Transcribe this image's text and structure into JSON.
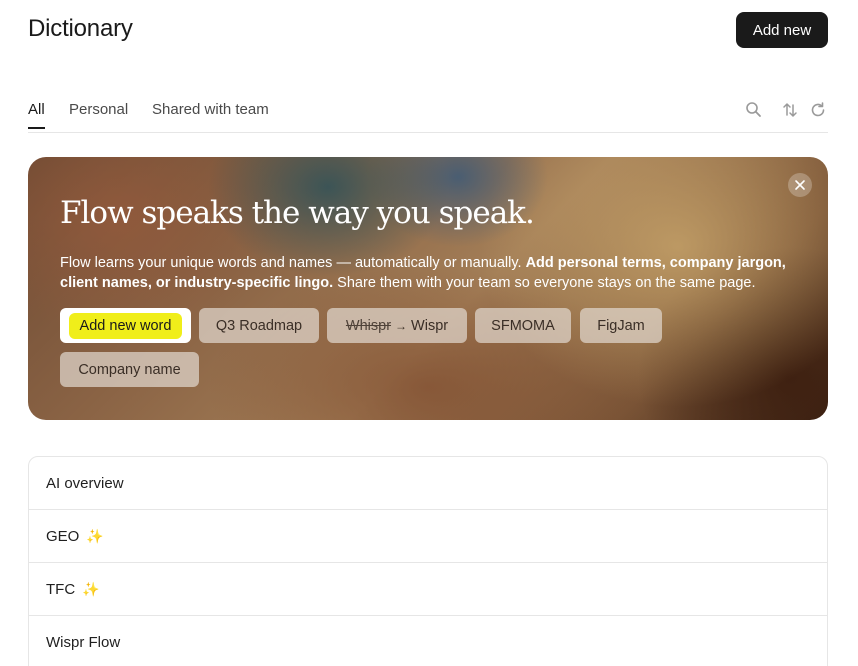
{
  "header": {
    "title": "Dictionary",
    "add_new_label": "Add new"
  },
  "tabs": [
    {
      "label": "All",
      "active": true
    },
    {
      "label": "Personal",
      "active": false
    },
    {
      "label": "Shared with team",
      "active": false
    }
  ],
  "toolbar_icons": [
    "search-icon",
    "sort-icon",
    "refresh-icon"
  ],
  "banner": {
    "heading": "Flow speaks the way you speak.",
    "text_plain_1": "Flow learns your unique words and names — automatically or manually. ",
    "text_bold": "Add personal terms, company jargon, client names, or industry-specific lingo.",
    "text_plain_2": " Share them with your team so everyone stays on the same page.",
    "chips": {
      "add_new_word": "Add new word",
      "q3_roadmap": "Q3 Roadmap",
      "whispr": "Whispr",
      "wispr": "Wispr",
      "sfmoma": "SFMOMA",
      "figjam": "FigJam",
      "company_name": "Company name"
    }
  },
  "list": {
    "items": [
      {
        "label": "AI overview",
        "sparkle": false
      },
      {
        "label": "GEO",
        "sparkle": true
      },
      {
        "label": "TFC",
        "sparkle": true
      },
      {
        "label": "Wispr Flow",
        "sparkle": false
      }
    ]
  },
  "colors": {
    "primary_button": "#1a1a1a",
    "highlight": "#f0ee1a",
    "sparkle": "#f0b429"
  }
}
